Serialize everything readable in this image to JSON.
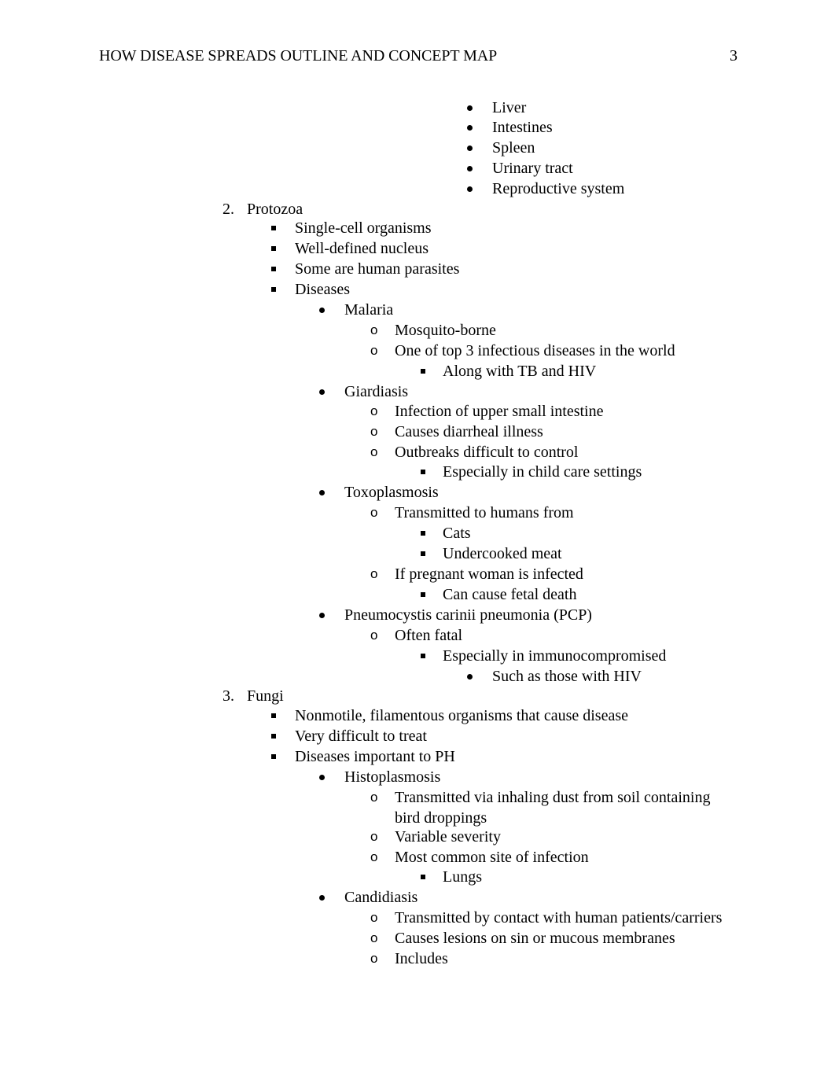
{
  "header": {
    "title": "HOW DISEASE SPREADS OUTLINE AND CONCEPT MAP",
    "page_number": "3"
  },
  "outline": [
    {
      "level": "disc4",
      "text": "Liver"
    },
    {
      "level": "disc4",
      "text": "Intestines"
    },
    {
      "level": "disc4",
      "text": "Spleen"
    },
    {
      "level": "disc4",
      "text": "Urinary tract"
    },
    {
      "level": "disc4",
      "text": "Reproductive system"
    },
    {
      "level": "num",
      "marker": "2.",
      "text": "Protozoa"
    },
    {
      "level": "square1",
      "text": "Single-cell organisms"
    },
    {
      "level": "square1",
      "text": "Well-defined nucleus"
    },
    {
      "level": "square1",
      "text": "Some are human parasites"
    },
    {
      "level": "square1",
      "text": "Diseases"
    },
    {
      "level": "disc2",
      "text": "Malaria"
    },
    {
      "level": "circle3",
      "text": "Mosquito-borne"
    },
    {
      "level": "circle3",
      "text": "One of top 3 infectious diseases in the world"
    },
    {
      "level": "square4",
      "text": "Along with TB and HIV"
    },
    {
      "level": "disc2",
      "text": "Giardiasis"
    },
    {
      "level": "circle3",
      "text": "Infection of upper small intestine"
    },
    {
      "level": "circle3",
      "text": "Causes diarrheal illness"
    },
    {
      "level": "circle3",
      "text": "Outbreaks difficult to control"
    },
    {
      "level": "square4",
      "text": "Especially in child care settings"
    },
    {
      "level": "disc2",
      "text": "Toxoplasmosis"
    },
    {
      "level": "circle3",
      "text": "Transmitted to humans from"
    },
    {
      "level": "square4",
      "text": "Cats"
    },
    {
      "level": "square4",
      "text": "Undercooked meat"
    },
    {
      "level": "circle3",
      "text": "If pregnant woman is infected"
    },
    {
      "level": "square4",
      "text": "Can cause fetal death"
    },
    {
      "level": "disc2",
      "text": "Pneumocystis carinii pneumonia (PCP)"
    },
    {
      "level": "circle3",
      "text": "Often fatal"
    },
    {
      "level": "square4",
      "text": "Especially in immunocompromised"
    },
    {
      "level": "disc4",
      "text": "Such as those with HIV"
    },
    {
      "level": "num",
      "marker": "3.",
      "text": "Fungi"
    },
    {
      "level": "square1",
      "text": "Nonmotile, filamentous organisms that cause disease"
    },
    {
      "level": "square1",
      "text": "Very difficult to treat"
    },
    {
      "level": "square1",
      "text": "Diseases important to PH"
    },
    {
      "level": "disc2",
      "text": "Histoplasmosis"
    },
    {
      "level": "circle3",
      "text": "Transmitted via inhaling dust from soil containing"
    },
    {
      "level": "cont3",
      "text": "bird droppings"
    },
    {
      "level": "circle3",
      "text": "Variable severity"
    },
    {
      "level": "circle3",
      "text": "Most common site of infection"
    },
    {
      "level": "square4",
      "text": "Lungs"
    },
    {
      "level": "disc2",
      "text": "Candidiasis"
    },
    {
      "level": "circle3",
      "text": "Transmitted by contact with human patients/carriers"
    },
    {
      "level": "circle3",
      "text": "Causes lesions on sin or mucous membranes"
    },
    {
      "level": "circle3",
      "text": "Includes"
    }
  ]
}
